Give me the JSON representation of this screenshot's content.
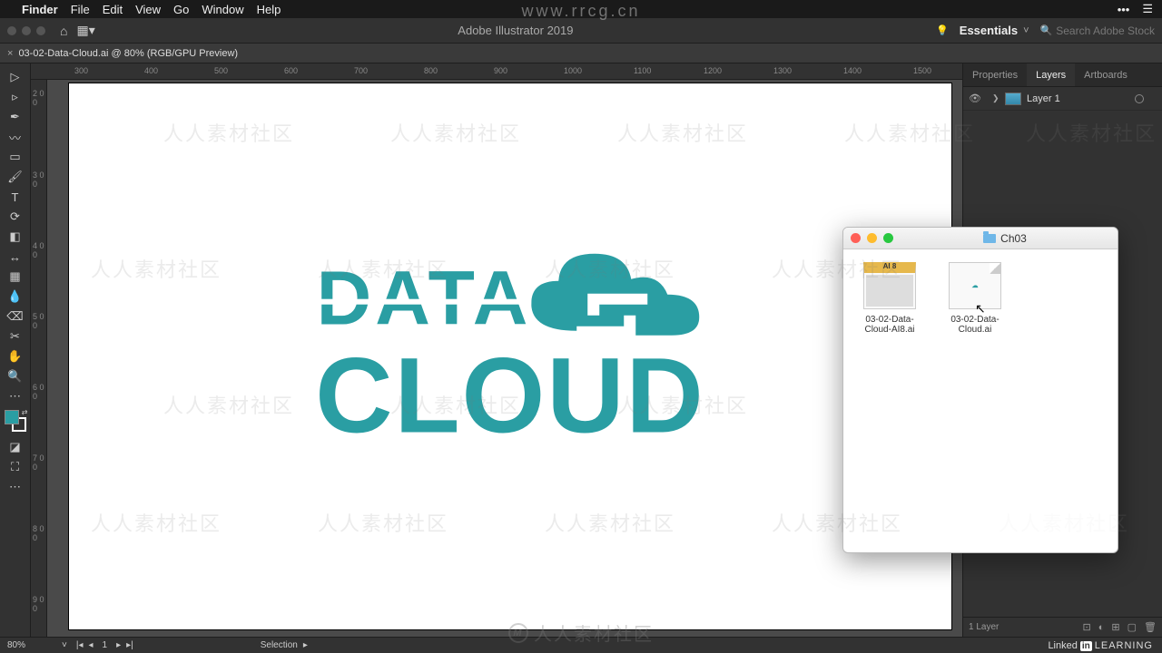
{
  "mac_menu": {
    "app": "Finder",
    "items": [
      "File",
      "Edit",
      "View",
      "Go",
      "Window",
      "Help"
    ]
  },
  "ai_topbar": {
    "title": "Adobe Illustrator 2019",
    "workspace": "Essentials",
    "search_placeholder": "Search Adobe Stock"
  },
  "document_tab": {
    "label": "03-02-Data-Cloud.ai @ 80% (RGB/GPU Preview)"
  },
  "ruler_ticks_h": [
    "300",
    "400",
    "500",
    "600",
    "700",
    "800",
    "900",
    "1000",
    "1100",
    "1200",
    "1300",
    "1400",
    "1500"
  ],
  "ruler_ticks_v": [
    "2 0 0",
    "3 0 0",
    "4 0 0",
    "5 0 0",
    "6 0 0",
    "7 0 0",
    "8 0 0",
    "9 0 0"
  ],
  "logo": {
    "line1": "DATA",
    "line2": "CLOUD",
    "color": "#2a9ea3"
  },
  "panel": {
    "tabs": [
      "Properties",
      "Layers",
      "Artboards"
    ],
    "active_tab": "Layers",
    "layer_name": "Layer 1",
    "footer_label": "1 Layer"
  },
  "statusbar": {
    "zoom": "80%",
    "page": "1",
    "mode": "Selection"
  },
  "finder": {
    "folder": "Ch03",
    "files": [
      {
        "name": "03-02-Data-Cloud-AI8.ai",
        "type": "ai8"
      },
      {
        "name": "03-02-Data-Cloud.ai",
        "type": "ai"
      }
    ]
  },
  "branding": {
    "linkedin_prefix": "Linked",
    "linkedin_box": "in",
    "linkedin_suffix": "LEARNING"
  },
  "watermark": {
    "url": "www.rrcg.cn",
    "text": "人人素材社区",
    "badge": "M"
  }
}
